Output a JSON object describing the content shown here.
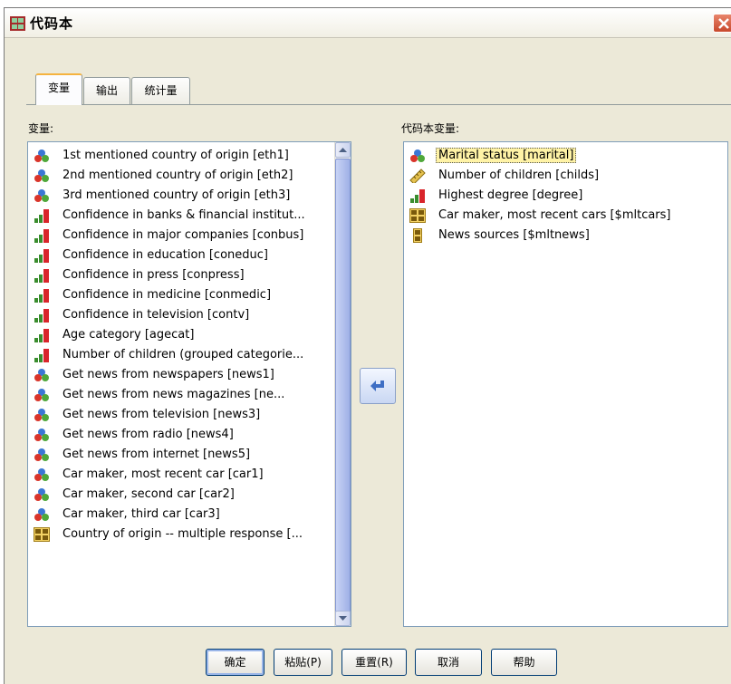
{
  "window": {
    "title": "代码本"
  },
  "tabs": [
    {
      "label": "变量",
      "active": true
    },
    {
      "label": "输出",
      "active": false
    },
    {
      "label": "统计量",
      "active": false
    }
  ],
  "variables_label": "变量:",
  "codebook_label": "代码本变量:",
  "variables": [
    {
      "label": "1st mentioned country of origin [eth1]",
      "icon": "nominal-icon"
    },
    {
      "label": "2nd mentioned country of origin [eth2]",
      "icon": "nominal-icon"
    },
    {
      "label": "3rd mentioned country of origin [eth3]",
      "icon": "nominal-icon"
    },
    {
      "label": "Confidence in banks & financial institut...",
      "icon": "ordinal-icon"
    },
    {
      "label": "Confidence in major companies [conbus]",
      "icon": "ordinal-icon"
    },
    {
      "label": "Confidence in education [coneduc]",
      "icon": "ordinal-icon"
    },
    {
      "label": "Confidence in press [conpress]",
      "icon": "ordinal-icon"
    },
    {
      "label": "Confidence in medicine [conmedic]",
      "icon": "ordinal-icon"
    },
    {
      "label": "Confidence in television [contv]",
      "icon": "ordinal-icon"
    },
    {
      "label": "Age category [agecat]",
      "icon": "ordinal-icon"
    },
    {
      "label": "Number of children (grouped categorie...",
      "icon": "ordinal-icon"
    },
    {
      "label": "Get news from newspapers [news1]",
      "icon": "nominal-icon"
    },
    {
      "label": "Get news from news magazines [ne...",
      "icon": "nominal-icon"
    },
    {
      "label": "Get news from television [news3]",
      "icon": "nominal-icon"
    },
    {
      "label": "Get news from radio [news4]",
      "icon": "nominal-icon"
    },
    {
      "label": "Get news from internet [news5]",
      "icon": "nominal-icon"
    },
    {
      "label": "Car maker, most recent car [car1]",
      "icon": "nominal-icon"
    },
    {
      "label": "Car maker, second car [car2]",
      "icon": "nominal-icon"
    },
    {
      "label": "Car maker, third car [car3]",
      "icon": "nominal-icon"
    },
    {
      "label": "Country of origin -- multiple response [...",
      "icon": "multiresponse-set-icon"
    }
  ],
  "codebook_variables": [
    {
      "label": "Marital status [marital]",
      "icon": "nominal-icon",
      "selected": true
    },
    {
      "label": "Number of children [childs]",
      "icon": "scale-icon",
      "selected": false
    },
    {
      "label": "Highest degree [degree]",
      "icon": "ordinal-icon",
      "selected": false
    },
    {
      "label": "Car maker, most recent cars [$mltcars]",
      "icon": "multiresponse-set-icon",
      "selected": false
    },
    {
      "label": "News sources [$mltnews]",
      "icon": "dichotomy-set-icon",
      "selected": false
    }
  ],
  "buttons": {
    "ok": "确定",
    "paste": "粘贴(P)",
    "reset": "重置(R)",
    "cancel": "取消",
    "help": "帮助"
  }
}
